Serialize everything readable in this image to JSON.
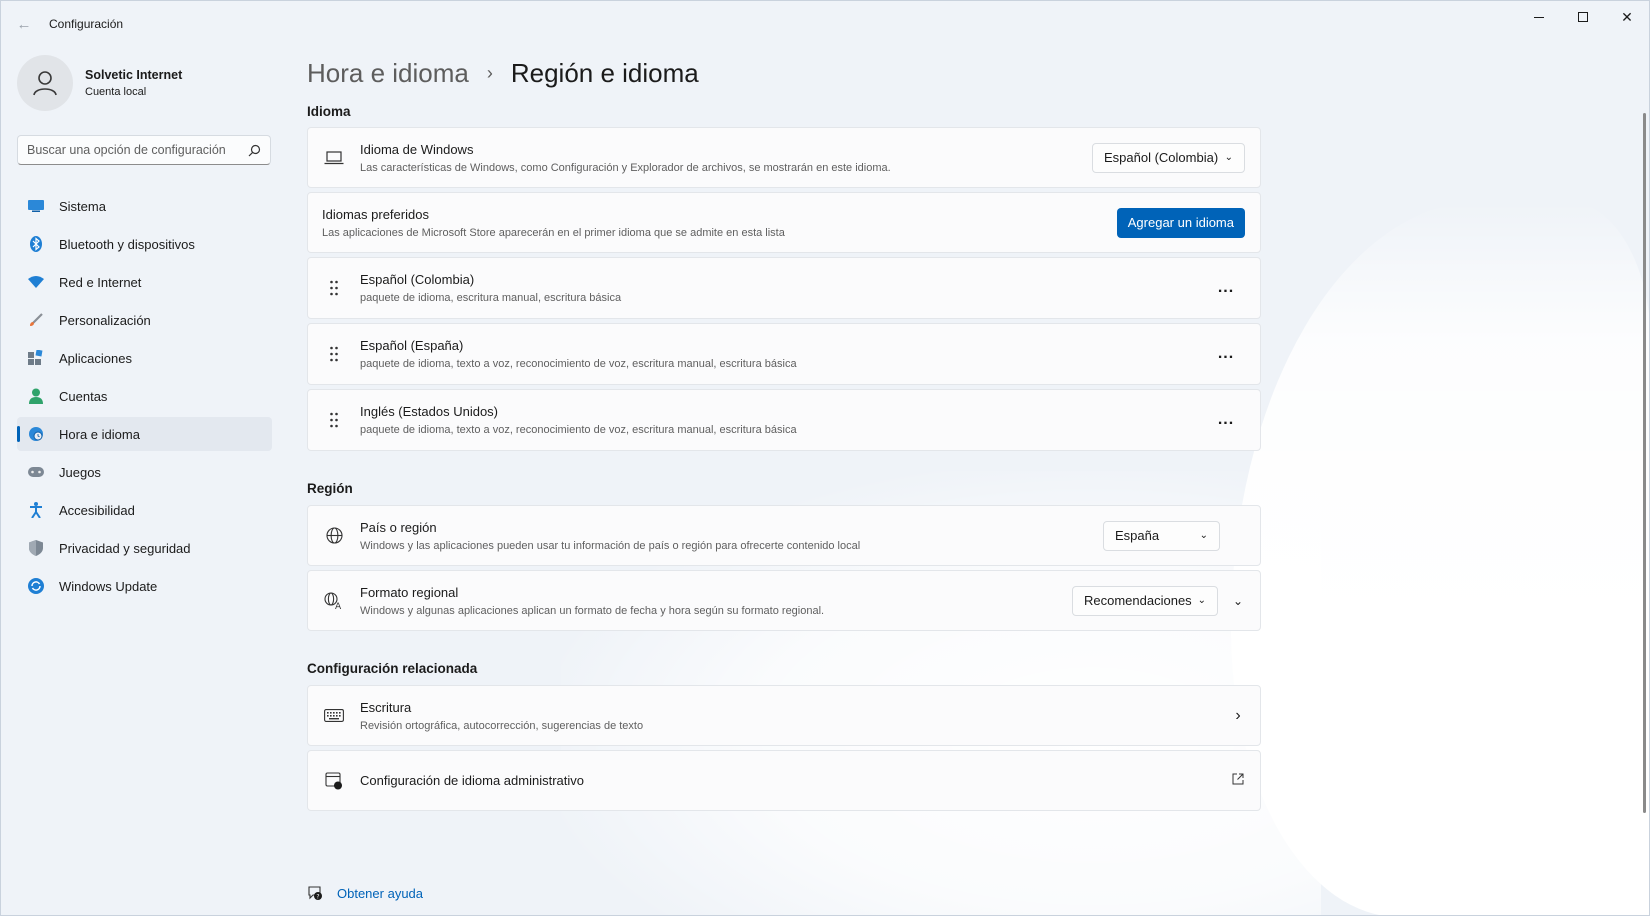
{
  "window": {
    "app_title": "Configuración"
  },
  "sidebar": {
    "user_name": "Solvetic Internet",
    "user_type": "Cuenta local",
    "search_placeholder": "Buscar una opción de configuración",
    "items": [
      {
        "label": "Sistema",
        "icon": "monitor-icon",
        "color": "#0078d4"
      },
      {
        "label": "Bluetooth y dispositivos",
        "icon": "bluetooth-icon",
        "color": "#0078d4"
      },
      {
        "label": "Red e Internet",
        "icon": "wifi-icon",
        "color": "#0078d4"
      },
      {
        "label": "Personalización",
        "icon": "brush-icon",
        "color": "#e0743a"
      },
      {
        "label": "Aplicaciones",
        "icon": "apps-icon",
        "color": "#5c6b7a"
      },
      {
        "label": "Cuentas",
        "icon": "person-icon",
        "color": "#2fa36b"
      },
      {
        "label": "Hora e idioma",
        "icon": "globe-clock-icon",
        "color": "#0078d4",
        "active": true
      },
      {
        "label": "Juegos",
        "icon": "gamepad-icon",
        "color": "#6b7785"
      },
      {
        "label": "Accesibilidad",
        "icon": "accessibility-icon",
        "color": "#0078d4"
      },
      {
        "label": "Privacidad y seguridad",
        "icon": "shield-icon",
        "color": "#6b7785"
      },
      {
        "label": "Windows Update",
        "icon": "update-icon",
        "color": "#0078d4"
      }
    ]
  },
  "header": {
    "parent": "Hora e idioma",
    "separator": "›",
    "current": "Región e idioma"
  },
  "language": {
    "section_title": "Idioma",
    "windows_language": {
      "title": "Idioma de Windows",
      "subtitle": "Las características de Windows, como Configuración y Explorador de archivos, se mostrarán en este idioma.",
      "value": "Español (Colombia)"
    },
    "preferred": {
      "title": "Idiomas preferidos",
      "subtitle": "Las aplicaciones de Microsoft Store aparecerán en el primer idioma que se admite en esta lista",
      "button": "Agregar un idioma"
    },
    "languages": [
      {
        "name": "Español (Colombia)",
        "features": "paquete de idioma, escritura manual, escritura básica"
      },
      {
        "name": "Español (España)",
        "features": "paquete de idioma, texto a voz, reconocimiento de voz, escritura manual, escritura básica"
      },
      {
        "name": "Inglés (Estados Unidos)",
        "features": "paquete de idioma, texto a voz, reconocimiento de voz, escritura manual, escritura básica"
      }
    ],
    "more_label": "..."
  },
  "region": {
    "section_title": "Región",
    "country": {
      "title": "País o región",
      "subtitle": "Windows y las aplicaciones pueden usar tu información de país o región para ofrecerte contenido local",
      "value": "España"
    },
    "format": {
      "title": "Formato regional",
      "subtitle": "Windows y algunas aplicaciones aplican un formato de fecha y hora según su formato regional.",
      "value": "Recomendaciones"
    }
  },
  "related": {
    "section_title": "Configuración relacionada",
    "typing": {
      "title": "Escritura",
      "subtitle": "Revisión ortográfica, autocorrección, sugerencias de texto"
    },
    "admin": {
      "title": "Configuración de idioma administrativo"
    }
  },
  "help": {
    "label": "Obtener ayuda"
  }
}
